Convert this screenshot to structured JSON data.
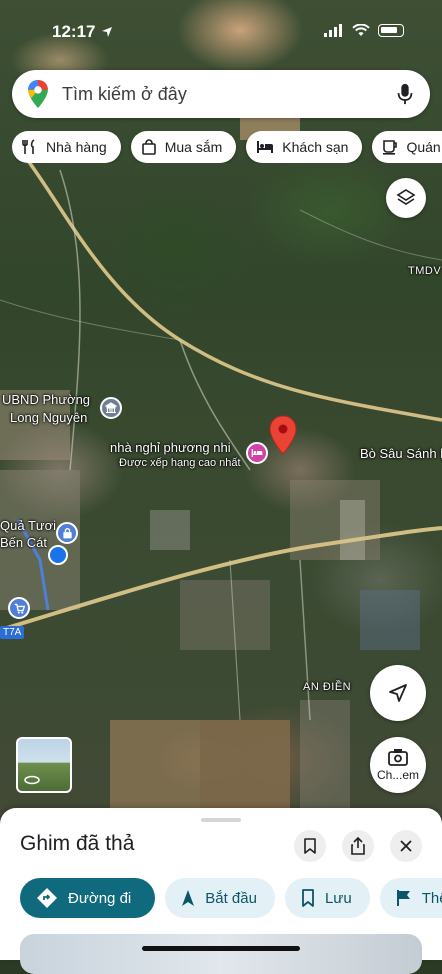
{
  "status": {
    "time": "12:17"
  },
  "search": {
    "placeholder": "Tìm kiếm ở đây"
  },
  "chips": [
    {
      "label": "Nhà hàng",
      "icon": "fork-knife-icon"
    },
    {
      "label": "Mua sắm",
      "icon": "shopping-bag-icon"
    },
    {
      "label": "Khách sạn",
      "icon": "bed-icon"
    },
    {
      "label": "Quán cà",
      "icon": "coffee-cup-icon"
    }
  ],
  "map_labels": {
    "ubnd_line1": "UBND Phường",
    "ubnd_line2": "Long Nguyên",
    "nha_nghi": "nhà nghỉ phương nhi",
    "nha_nghi_sub": "Được xếp hạng cao nhất",
    "bo_sau": "Bò Sâu Sánh l",
    "qua_tuoi_line1": "Quả Tươi",
    "qua_tuoi_line2": "Bến Cát",
    "tmdv": "TMDV",
    "an_dien": "AN ĐIỀN",
    "road_7a": "T7A",
    "camera_label": "Ch...em"
  },
  "sheet": {
    "title": "Ghim đã thả",
    "actions": [
      {
        "label": "Đường đi",
        "icon": "directions-icon"
      },
      {
        "label": "Bắt đầu",
        "icon": "navigation-arrow-icon"
      },
      {
        "label": "Lưu",
        "icon": "bookmark-icon"
      },
      {
        "label": "Thêm",
        "icon": "flag-icon"
      }
    ]
  },
  "colors": {
    "primary_teal": "#0f6a7e",
    "chip_teal_bg": "#e3f1f6",
    "pin_red": "#ea4335",
    "hotel_pink": "#d142a8",
    "blue_dot": "#1a73e8"
  }
}
